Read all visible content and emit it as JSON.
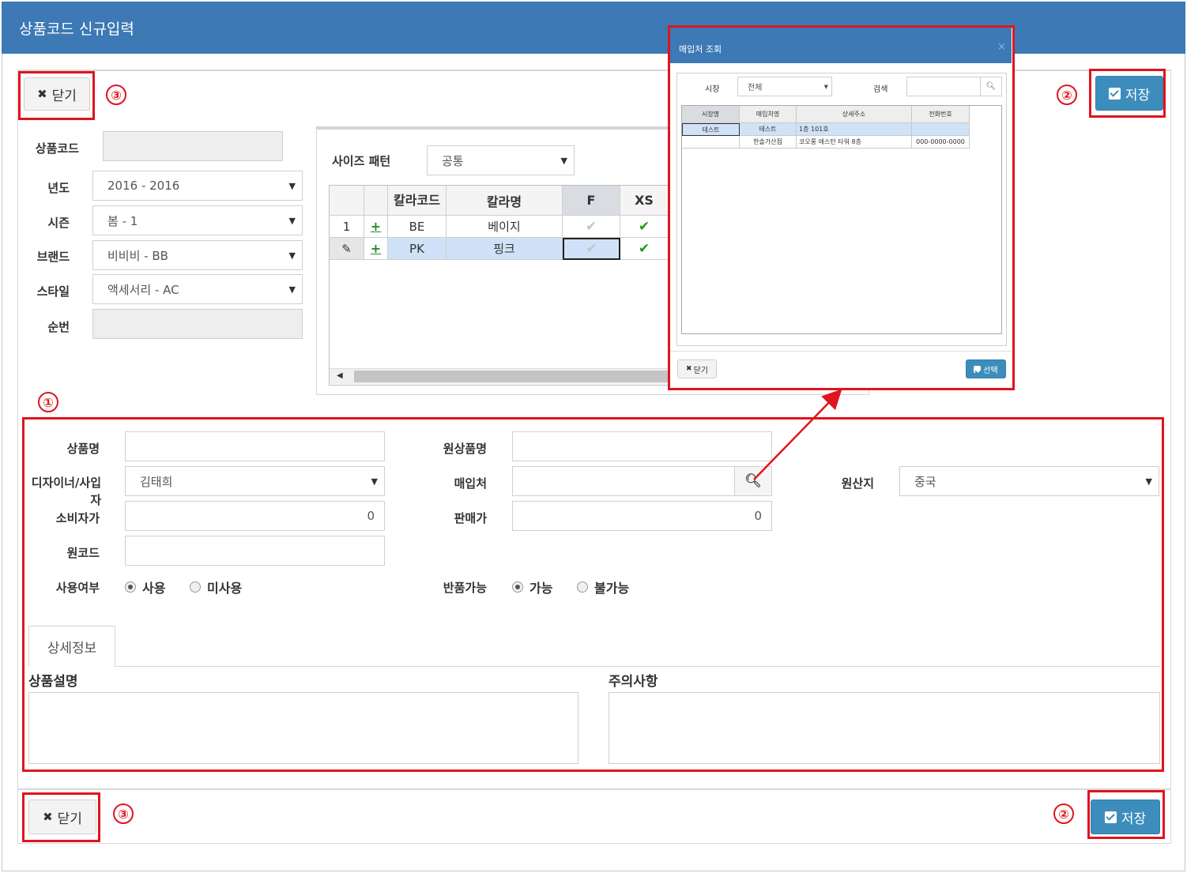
{
  "window": {
    "title": "상품코드 신규입력"
  },
  "toolbar": {
    "close_label": "닫기",
    "save_label": "저장"
  },
  "annotations": {
    "marker1": "①",
    "marker2": "②",
    "marker3": "③"
  },
  "header_form": {
    "product_code": {
      "label": "상품코드",
      "value": ""
    },
    "year": {
      "label": "년도",
      "value": "2016 - 2016"
    },
    "season": {
      "label": "시즌",
      "value": "봄 - 1"
    },
    "brand": {
      "label": "브랜드",
      "value": "비비비 - BB"
    },
    "style": {
      "label": "스타일",
      "value": "액세서리 - AC"
    },
    "serial": {
      "label": "순번",
      "value": ""
    }
  },
  "size_grid": {
    "pattern_label": "사이즈 패턴",
    "pattern_value": "공통",
    "columns": [
      "",
      "",
      "칼라코드",
      "칼라명",
      "F",
      "XS"
    ],
    "rows": [
      {
        "num": "1",
        "action": "+",
        "code": "BE",
        "name": "베이지",
        "F": false,
        "XS": true
      },
      {
        "num": "✎",
        "action": "+",
        "code": "PK",
        "name": "핑크",
        "F": false,
        "XS": true
      }
    ]
  },
  "detail_form": {
    "product_name": {
      "label": "상품명",
      "value": ""
    },
    "orig_product_name": {
      "label": "원상품명",
      "value": ""
    },
    "designer": {
      "label": "디자이너/사입자",
      "value": "김태희"
    },
    "vendor": {
      "label": "매입처",
      "value": ""
    },
    "origin": {
      "label": "원산지",
      "value": "중국"
    },
    "consumer_price": {
      "label": "소비자가",
      "value": "0"
    },
    "sale_price": {
      "label": "판매가",
      "value": "0"
    },
    "orig_code": {
      "label": "원코드",
      "value": ""
    },
    "use": {
      "label": "사용여부",
      "options": [
        "사용",
        "미사용"
      ],
      "selected": "사용"
    },
    "returnable": {
      "label": "반품가능",
      "options": [
        "가능",
        "불가능"
      ],
      "selected": "가능"
    },
    "tab_label": "상세정보",
    "description_label": "상품설명",
    "caution_label": "주의사항"
  },
  "popup": {
    "title": "매입처 조회",
    "close_x": "×",
    "market_label": "시장",
    "market_value": "전체",
    "search_label": "검색",
    "search_value": "",
    "columns": [
      "시장명",
      "매입처명",
      "상세주소",
      "전화번호"
    ],
    "rows": [
      {
        "market": "테스트",
        "vendor": "테스트",
        "address": "1층 101호",
        "phone": ""
      },
      {
        "market": "",
        "vendor": "한솔가산점",
        "address": "코오롱 애스턴 타워 8층",
        "phone": "000-0000-0000"
      }
    ],
    "close_label": "닫기",
    "select_label": "선택"
  },
  "colors": {
    "header": "#3c79b5",
    "primary_button": "#3c8dbc",
    "highlight": "#e0141e",
    "selected_row": "#cfe2f7"
  }
}
